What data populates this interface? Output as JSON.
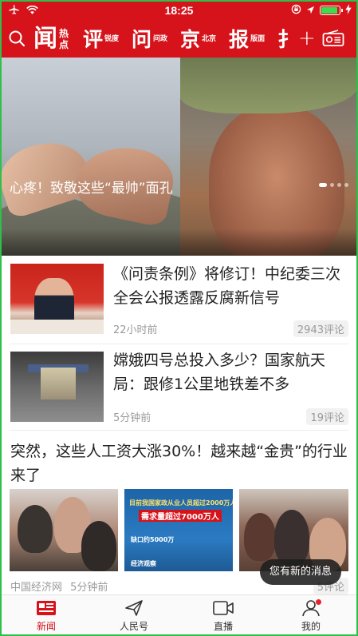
{
  "status_bar": {
    "time": "18:25"
  },
  "nav": {
    "categories": [
      {
        "main": "闻",
        "sub": "热点"
      },
      {
        "main": "评",
        "sub": "锐度"
      },
      {
        "main": "问",
        "sub": "问政"
      },
      {
        "main": "京",
        "sub": "北京"
      },
      {
        "main": "报",
        "sub": "版面"
      },
      {
        "main": "扌",
        "sub": ""
      }
    ],
    "plus": "+"
  },
  "carousel": {
    "caption": "心疼！致敬这些“最帅”面孔"
  },
  "news": [
    {
      "headline": "《问责条例》将修订！中纪委三次全会公报透露反腐新信号",
      "time": "22小时前",
      "comments": "2943评论"
    },
    {
      "headline": "嫦娥四号总投入多少？国家航天局：跟修1公里地铁差不多",
      "time": "5分钟前",
      "comments": "19评论"
    },
    {
      "headline": "突然，这些人工资大涨30%！越来越“金贵”的行业来了",
      "source": "中国经济网",
      "time": "5分钟前",
      "comments": "5评论"
    }
  ],
  "infographic": {
    "line1": "目前我国家政从业人员超过2000万人",
    "line2": "需求量超过7000万人",
    "line3": "缺口约5000万",
    "line4": "经济观察"
  },
  "toast": "您有新的消息",
  "tabs": [
    {
      "label": "新闻"
    },
    {
      "label": "人民号"
    },
    {
      "label": "直播"
    },
    {
      "label": "我的"
    }
  ],
  "colors": {
    "brand": "#d6131a",
    "frame": "#2fbf4a",
    "badge": "#e8212a"
  }
}
